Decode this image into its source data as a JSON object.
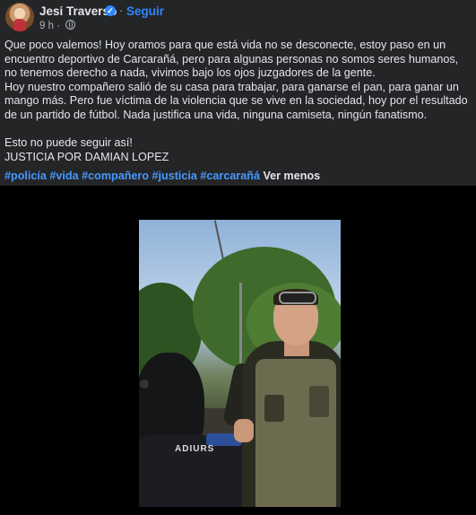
{
  "post": {
    "author": "Jesi Traverso",
    "follow_label": "Seguir",
    "dot": "·",
    "time": "9 h",
    "time_separator": "·",
    "paragraph1": "Que poco valemos! Hoy oramos para que está vida no se desconecte, estoy paso en un encuentro deportivo de Carcarañá, pero para algunas personas no somos seres humanos, no tenemos derecho a nada, vivimos bajo los ojos juzgadores de la gente.",
    "paragraph2": "Hoy nuestro compañero salió de su casa para trabajar, para ganarse el pan, para ganar un mango más. Pero fue víctima de la violencia  que se vive en la sociedad, hoy por el resultado de un partido de fútbol. Nada justifica una vida, ninguna camiseta, ningún fanatismo.",
    "paragraph3": "Esto no puede seguir así!",
    "paragraph4": "JUSTICIA POR DAMIAN LOPEZ",
    "hashtags": [
      "#policía",
      "#vida",
      "#compañero",
      "#justicia",
      "#carcarañá"
    ],
    "see_less": "Ver menos",
    "image_text": "ADIURS"
  }
}
